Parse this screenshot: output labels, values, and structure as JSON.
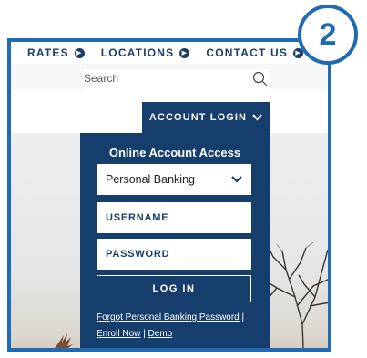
{
  "nav": {
    "items": [
      {
        "label": "RATES"
      },
      {
        "label": "LOCATIONS"
      },
      {
        "label": "CONTACT US"
      }
    ]
  },
  "search": {
    "placeholder": "Search",
    "icon": "search-icon"
  },
  "account_tab": {
    "label": "ACCOUNT LOGIN"
  },
  "panel": {
    "title": "Online Account Access",
    "select_value": "Personal Banking",
    "username_placeholder": "USERNAME",
    "password_placeholder": "PASSWORD",
    "login_label": "LOG IN",
    "forgot_link": "Forgot Personal Banking Password",
    "enroll_link": "Enroll Now",
    "demo_link": "Demo",
    "separator": "|"
  },
  "badge": {
    "number": "2"
  },
  "colors": {
    "navy": "#153e6d",
    "frame_blue": "#1f6bb5",
    "nav_text": "#1c3e6b"
  }
}
